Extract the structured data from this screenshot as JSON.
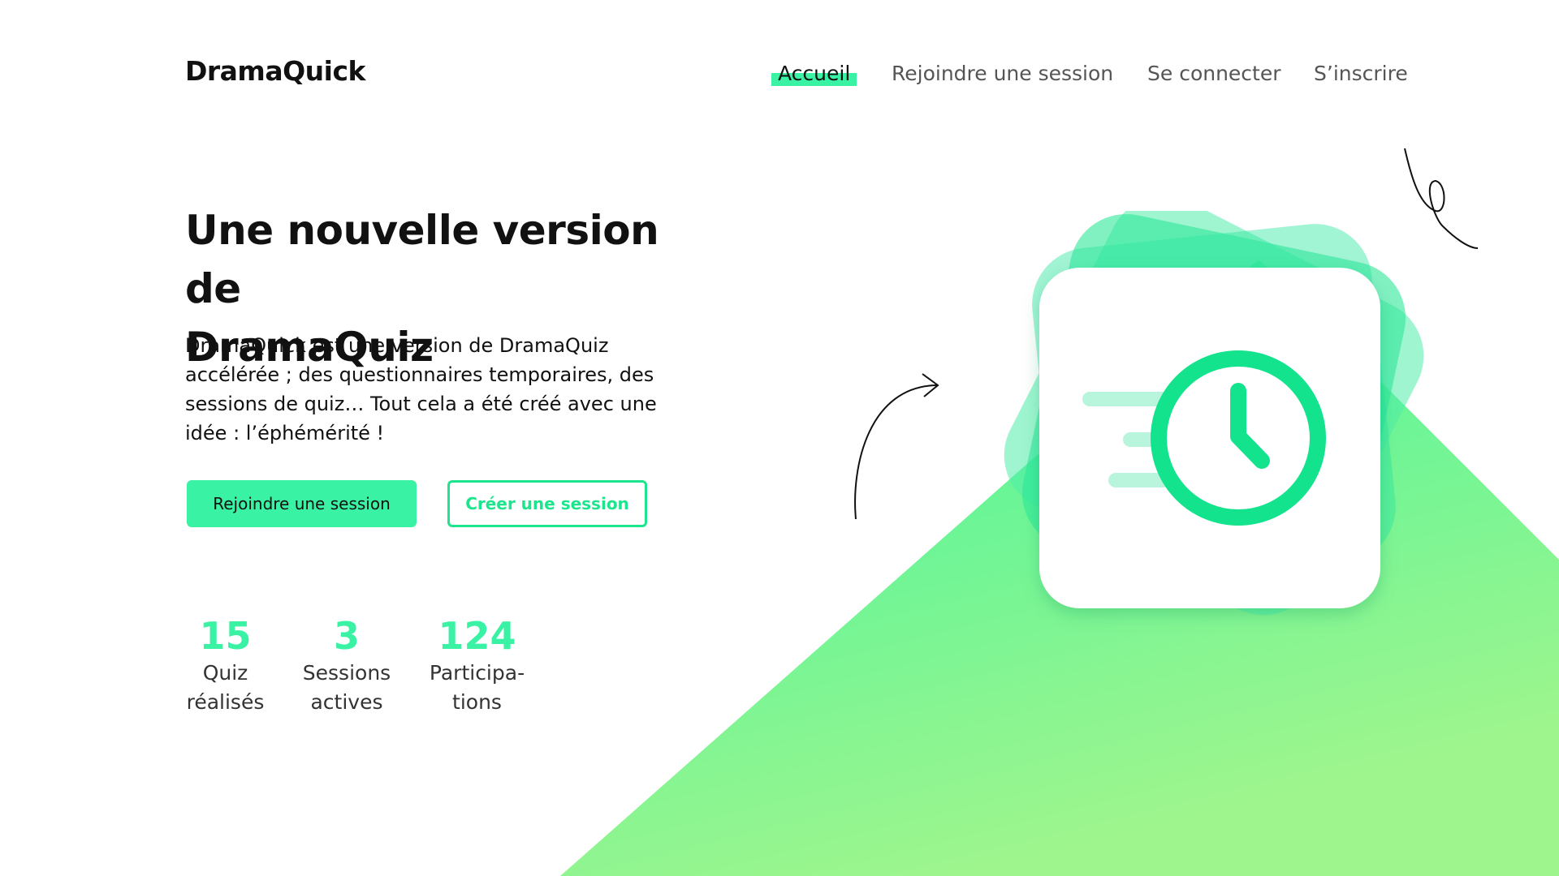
{
  "header": {
    "logo": "DramaQuick",
    "nav": [
      {
        "label": "Accueil",
        "active": true
      },
      {
        "label": "Rejoindre une session",
        "active": false
      },
      {
        "label": "Se connecter",
        "active": false
      },
      {
        "label": "S’inscrire",
        "active": false
      }
    ]
  },
  "hero": {
    "title_line1": "Une nouvelle version de",
    "title_line2": "DramaQuiz",
    "description": "DramaQuick est une version de DramaQuiz accélérée ; des questionnaires temporaires, des sessions de quiz… Tout cela a été créé avec une idée : l’éphémérité !",
    "primary_button": "Rejoindre une session",
    "secondary_button": "Créer une session"
  },
  "stats": [
    {
      "value": "15",
      "label_line1": "Quiz",
      "label_line2": "réalisés"
    },
    {
      "value": "3",
      "label_line1": "Sessions",
      "label_line2": "actives"
    },
    {
      "value": "124",
      "label_line1": "Participa-",
      "label_line2": "tions"
    }
  ],
  "illustration": {
    "icon": "clock-icon"
  },
  "colors": {
    "accent": "#3af2a4",
    "accent_dark": "#1de58d",
    "gradient_end": "#9ef58d"
  }
}
